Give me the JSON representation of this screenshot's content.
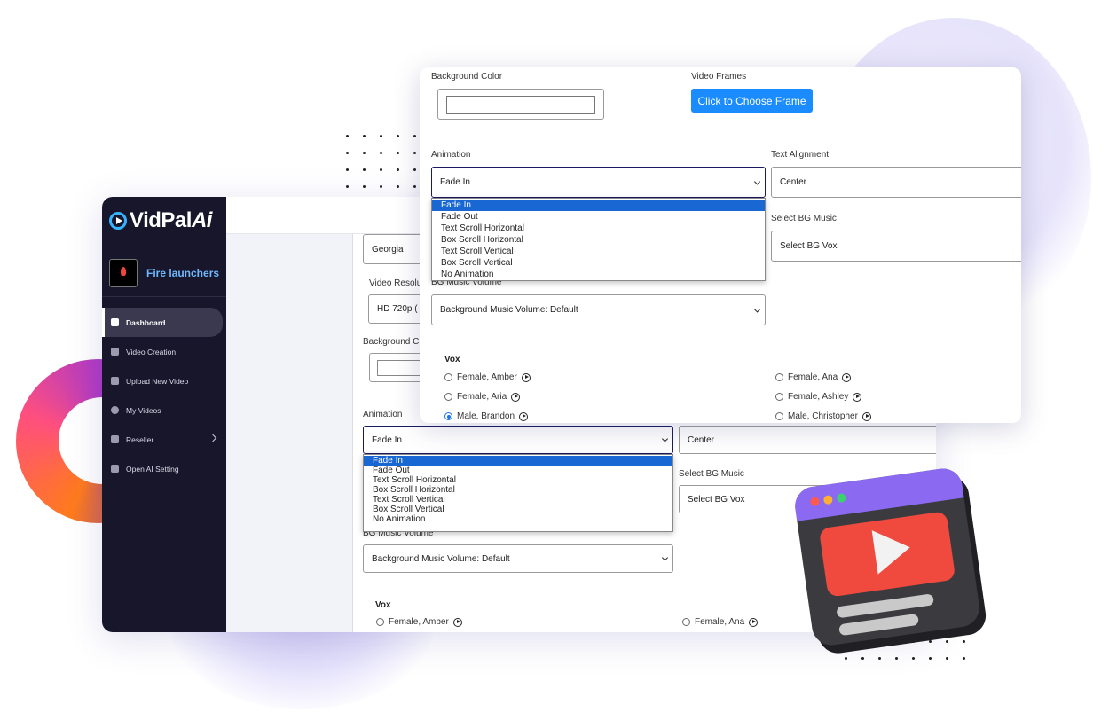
{
  "brand": {
    "name": "VidPal",
    "suffix": "Ai"
  },
  "profile": {
    "name": "Fire launchers"
  },
  "sidebar": {
    "items": [
      {
        "label": "Dashboard",
        "icon": "home-icon"
      },
      {
        "label": "Video Creation",
        "icon": "clapper-icon"
      },
      {
        "label": "Upload New Video",
        "icon": "file-icon"
      },
      {
        "label": "My Videos",
        "icon": "play-circle-icon"
      },
      {
        "label": "Reseller",
        "icon": "users-icon"
      },
      {
        "label": "Open AI Setting",
        "icon": "user-gear-icon"
      }
    ]
  },
  "back": {
    "language_value": "Georgia",
    "video_resolution_label": "Video Resolu",
    "video_resolution_value": "HD 720p (",
    "background_color_label": "Background C",
    "animation_label": "Animation",
    "animation_value": "Fade In",
    "animation_options": [
      "Fade In",
      "Fade Out",
      "Text Scroll Horizontal",
      "Box Scroll Horizontal",
      "Text Scroll Vertical",
      "Box Scroll Vertical",
      "No Animation"
    ],
    "text_alignment_value": "Center",
    "bg_music_label": "Select BG Music",
    "bg_music_value": "Select BG Vox",
    "bg_volume_label": "BG Music Volume",
    "bg_volume_value": "Background Music Volume: Default",
    "vox_title": "Vox",
    "vox_options": [
      "Female, Amber",
      "Female, Ana"
    ]
  },
  "front": {
    "background_color_label": "Background Color",
    "video_frames_label": "Video Frames",
    "choose_frame_button": "Click to Choose Frame",
    "animation_label": "Animation",
    "animation_value": "Fade In",
    "animation_options": [
      "Fade In",
      "Fade Out",
      "Text Scroll Horizontal",
      "Box Scroll Horizontal",
      "Text Scroll Vertical",
      "Box Scroll Vertical",
      "No Animation"
    ],
    "text_alignment_label": "Text Alignment",
    "text_alignment_value": "Center",
    "bg_music_label": "Select BG Music",
    "bg_music_value": "Select BG Vox",
    "bg_volume_label": "BG Music Volume",
    "bg_volume_value": "Background Music Volume: Default",
    "vox_title": "Vox",
    "vox_options": [
      "Female, Amber",
      "Female, Ana",
      "Female, Aria",
      "Female, Ashley",
      "Male, Brandon",
      "Male, Christopher"
    ],
    "vox_selected": "Male, Brandon"
  },
  "colors": {
    "sidebar": "#17162a",
    "primary": "#1a8cff",
    "highlight": "#1967d2"
  }
}
